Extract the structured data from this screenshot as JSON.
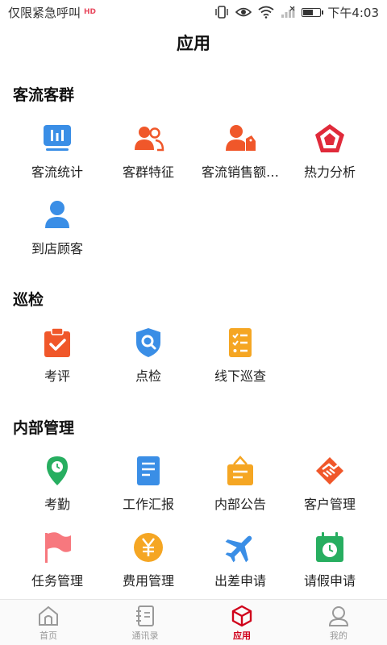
{
  "status": {
    "carrier": "仅限紧急呼叫",
    "hd": "HD",
    "time": "下午4:03"
  },
  "page": {
    "title": "应用"
  },
  "sections": [
    {
      "title": "客流客群",
      "items": [
        {
          "label": "客流统计",
          "icon": "bar-chart-icon",
          "color": "#3a8ee6"
        },
        {
          "label": "客群特征",
          "icon": "user-group-icon",
          "color": "#f0572a"
        },
        {
          "label": "客流销售额…",
          "icon": "user-sales-icon",
          "color": "#f0572a"
        },
        {
          "label": "热力分析",
          "icon": "heat-pentagon-icon",
          "color": "#e02a3a"
        },
        {
          "label": "到店顾客",
          "icon": "person-icon",
          "color": "#3a8ee6"
        }
      ]
    },
    {
      "title": "巡检",
      "items": [
        {
          "label": "考评",
          "icon": "clipboard-check-icon",
          "color": "#f0572a"
        },
        {
          "label": "点检",
          "icon": "shield-search-icon",
          "color": "#3a8ee6"
        },
        {
          "label": "线下巡查",
          "icon": "checklist-icon",
          "color": "#f5a623"
        }
      ]
    },
    {
      "title": "内部管理",
      "items": [
        {
          "label": "考勤",
          "icon": "location-pin-icon",
          "color": "#27ae60"
        },
        {
          "label": "工作汇报",
          "icon": "document-icon",
          "color": "#3a8ee6"
        },
        {
          "label": "内部公告",
          "icon": "announcement-icon",
          "color": "#f5a623"
        },
        {
          "label": "客户管理",
          "icon": "handshake-icon",
          "color": "#f0572a"
        },
        {
          "label": "任务管理",
          "icon": "flag-icon",
          "color": "#f7787e"
        },
        {
          "label": "费用管理",
          "icon": "yen-coin-icon",
          "color": "#f5a623"
        },
        {
          "label": "出差申请",
          "icon": "airplane-icon",
          "color": "#3a8ee6"
        },
        {
          "label": "请假申请",
          "icon": "calendar-clock-icon",
          "color": "#27ae60"
        }
      ]
    }
  ],
  "nav": [
    {
      "label": "首页",
      "icon": "home-icon",
      "active": false
    },
    {
      "label": "通讯录",
      "icon": "contacts-book-icon",
      "active": false
    },
    {
      "label": "应用",
      "icon": "cube-icon",
      "active": true
    },
    {
      "label": "我的",
      "icon": "user-profile-icon",
      "active": false
    }
  ],
  "colors": {
    "accent": "#d0021b",
    "inactive": "#999999"
  }
}
